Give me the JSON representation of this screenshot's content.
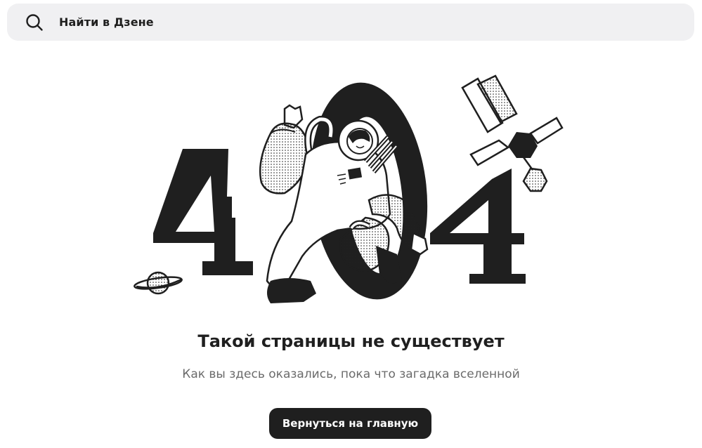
{
  "search": {
    "placeholder": "Найти в Дзене",
    "icon": "search-icon"
  },
  "error": {
    "code_digits": [
      "4",
      "0",
      "4"
    ],
    "title": "Такой страницы не существует",
    "subtitle": "Как вы здесь оказались, пока что загадка вселенной",
    "button_label": "Вернуться на главную"
  },
  "colors": {
    "text": "#1f1f1f",
    "muted": "#6b6b6b",
    "search_bg": "#f0f0f2",
    "button_bg": "#1f1f1f",
    "button_text": "#ffffff"
  }
}
